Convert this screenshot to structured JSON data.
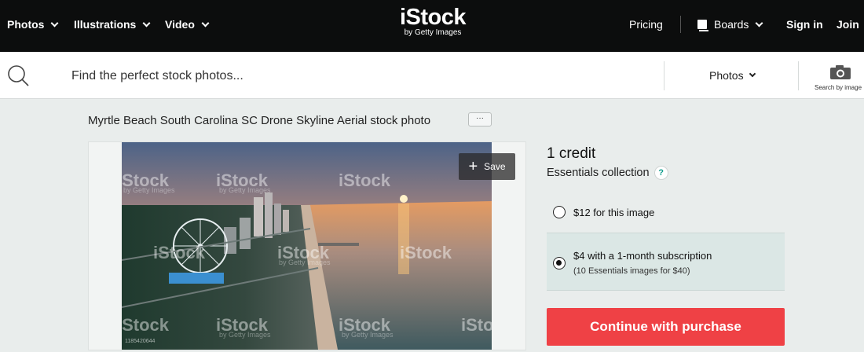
{
  "nav": {
    "photos": "Photos",
    "illustrations": "Illustrations",
    "video": "Video",
    "logo_main": "iStock",
    "logo_sub": "by Getty Images",
    "pricing": "Pricing",
    "boards": "Boards",
    "sign_in": "Sign in",
    "join": "Join"
  },
  "search": {
    "placeholder": "Find the perfect stock photos...",
    "type": "Photos",
    "search_by_image": "Search by image"
  },
  "photo": {
    "title": "Myrtle Beach South Carolina SC Drone Skyline Aerial stock photo",
    "more_label": "···",
    "save_label": "Save",
    "watermark_main": "iStock",
    "watermark_sub": "by Getty Images",
    "image_id": "1185420644"
  },
  "purchase": {
    "credit_title": "1 credit",
    "collection": "Essentials collection",
    "help": "?",
    "option1": "$12 for this image",
    "option2": "$4 with a 1-month subscription",
    "option2_sub": "(10 Essentials images for $40)",
    "cta": "Continue with purchase"
  },
  "colors": {
    "nav_bg": "#0c0d0d",
    "page_bg": "#e9edec",
    "cta": "#ef4145",
    "selected_option_bg": "#dbe7e5",
    "help_accent": "#0e9c8c"
  }
}
